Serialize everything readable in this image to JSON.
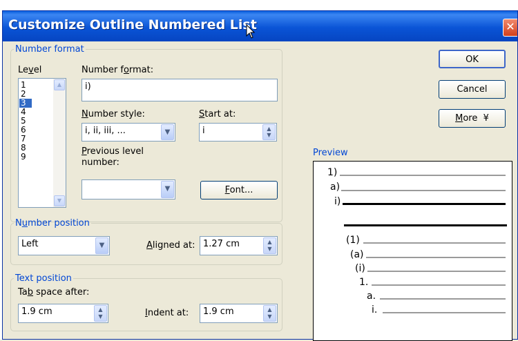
{
  "dialog": {
    "title": "Customize Outline Numbered List",
    "close_glyph": "✕"
  },
  "number_format_group": {
    "legend": "Number format",
    "level_label": "Level",
    "levels": [
      "1",
      "2",
      "3",
      "4",
      "5",
      "6",
      "7",
      "8",
      "9"
    ],
    "selected_level": "3",
    "number_format_label": "Number format:",
    "number_format_value": "i)",
    "number_style_label": "Number style:",
    "number_style_value": "i, ii, iii, ...",
    "start_at_label": "Start at:",
    "start_at_value": "i",
    "previous_level_label_1": "Previous level",
    "previous_level_label_2": "number:",
    "previous_level_value": "",
    "font_button": "Font..."
  },
  "number_position_group": {
    "legend": "Number position",
    "alignment_value": "Left",
    "aligned_at_label": "Aligned at:",
    "aligned_at_value": "1.27 cm"
  },
  "text_position_group": {
    "legend": "Text position",
    "tab_space_label": "Tab space after:",
    "tab_space_value": "1.9 cm",
    "indent_at_label": "Indent at:",
    "indent_at_value": "1.9 cm"
  },
  "buttons": {
    "ok": "OK",
    "cancel": "Cancel",
    "more": "More",
    "more_glyph": "¥"
  },
  "preview": {
    "label": "Preview",
    "entries": [
      "1)",
      "a)",
      "i)",
      "(1)",
      "(a)",
      "(i)",
      "1.",
      "a.",
      "i."
    ]
  },
  "icons": {
    "dropdown": "▼",
    "spin_up": "▲",
    "spin_down": "▼"
  }
}
